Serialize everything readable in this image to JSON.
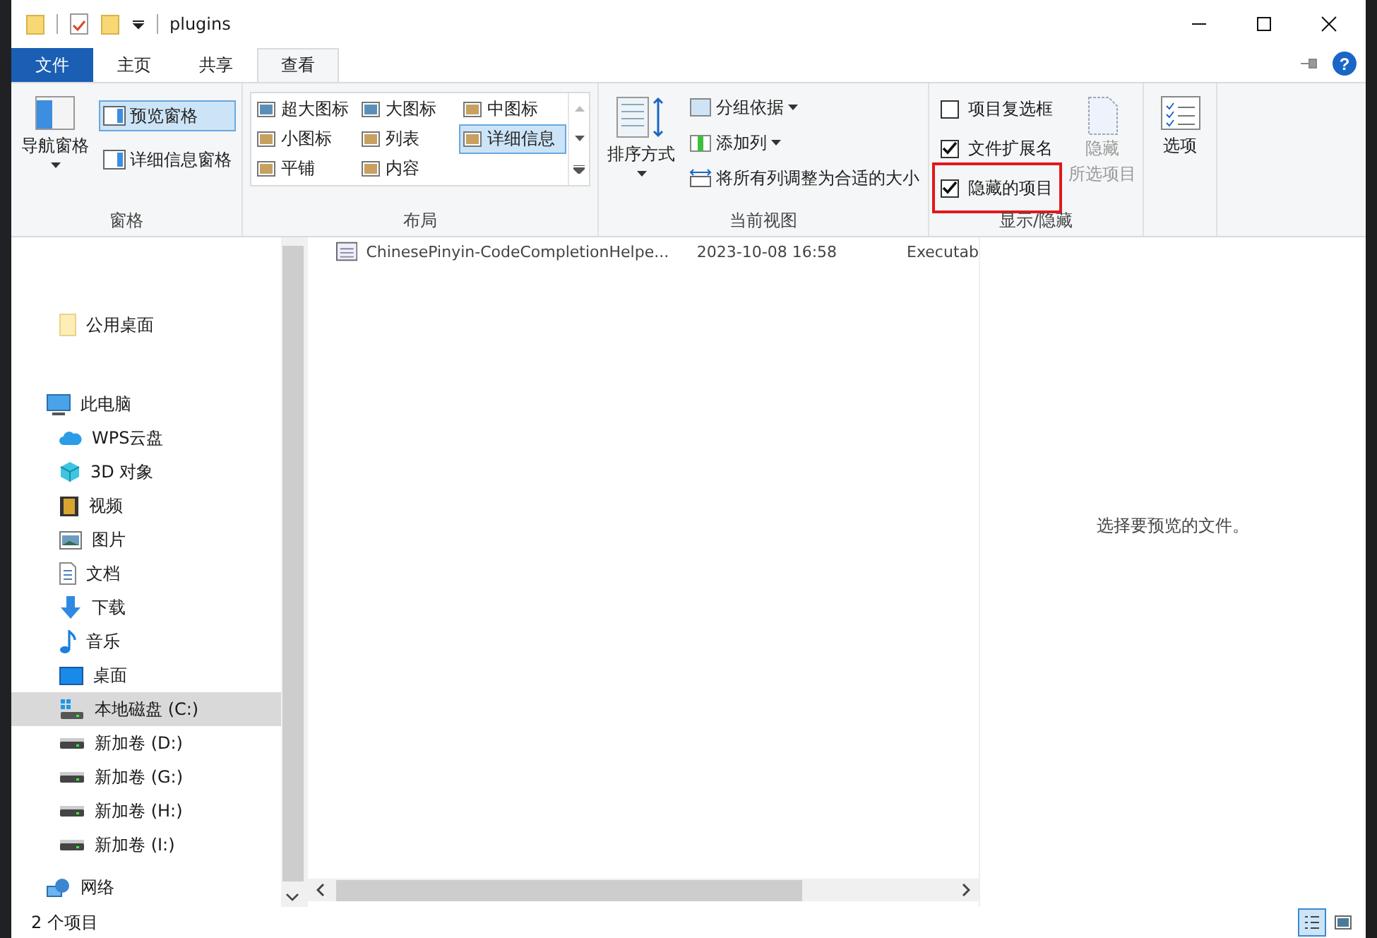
{
  "window": {
    "title": "plugins"
  },
  "ribbon_tabs": [
    {
      "label": "文件",
      "kind": "file",
      "selected": false
    },
    {
      "label": "主页",
      "kind": "normal",
      "selected": false
    },
    {
      "label": "共享",
      "kind": "normal",
      "selected": false
    },
    {
      "label": "查看",
      "kind": "normal",
      "selected": true
    }
  ],
  "panes_group": {
    "label": "窗格",
    "navigation_pane": "导航窗格",
    "preview_pane": {
      "label": "预览窗格",
      "selected": true
    },
    "details_pane": {
      "label": "详细信息窗格",
      "selected": false
    }
  },
  "layout_group": {
    "label": "布局",
    "options": [
      {
        "label": "超大图标",
        "selected": false
      },
      {
        "label": "大图标",
        "selected": false
      },
      {
        "label": "中图标",
        "selected": false
      },
      {
        "label": "小图标",
        "selected": false
      },
      {
        "label": "列表",
        "selected": false
      },
      {
        "label": "详细信息",
        "selected": true
      },
      {
        "label": "平铺",
        "selected": false
      },
      {
        "label": "内容",
        "selected": false
      }
    ]
  },
  "current_view_group": {
    "label": "当前视图",
    "sort_by": "排序方式",
    "group_by": "分组依据",
    "add_columns": "添加列",
    "size_all_columns": "将所有列调整为合适的大小"
  },
  "show_hide_group": {
    "label": "显示/隐藏",
    "checkboxes": [
      {
        "label": "项目复选框",
        "checked": false,
        "highlighted": false
      },
      {
        "label": "文件扩展名",
        "checked": true,
        "highlighted": false
      },
      {
        "label": "隐藏的项目",
        "checked": true,
        "highlighted": true
      }
    ],
    "hide_selected": {
      "line_1": "隐藏",
      "line_2": "所选项目",
      "disabled": true
    }
  },
  "options_button": "选项",
  "help_button": "?",
  "navigation": [
    {
      "children": [
        {
          "label": "公用桌面",
          "kind": "folder",
          "selected": false
        }
      ]
    },
    {
      "label": "此电脑",
      "children": [
        {
          "label": "WPS云盘",
          "kind": "cloud",
          "selected": false
        },
        {
          "label": "3D 对象",
          "kind": "cube",
          "selected": false
        },
        {
          "label": "视频",
          "kind": "video",
          "selected": false
        },
        {
          "label": "图片",
          "kind": "picture",
          "selected": false
        },
        {
          "label": "文档",
          "kind": "document",
          "selected": false
        },
        {
          "label": "下载",
          "kind": "download",
          "selected": false
        },
        {
          "label": "音乐",
          "kind": "music",
          "selected": false
        },
        {
          "label": "桌面",
          "kind": "desktop",
          "selected": false
        },
        {
          "label": "本地磁盘 (C:)",
          "kind": "system-drive",
          "selected": true
        },
        {
          "label": "新加卷 (D:)",
          "kind": "drive",
          "selected": false
        },
        {
          "label": "新加卷 (G:)",
          "kind": "drive",
          "selected": false
        },
        {
          "label": "新加卷 (H:)",
          "kind": "drive",
          "selected": false
        },
        {
          "label": "新加卷 (I:)",
          "kind": "drive",
          "selected": false
        }
      ]
    },
    {
      "label": "网络"
    }
  ],
  "files": [
    {
      "name": "ChinesePinyin-CodeCompletionHelpe...",
      "date": "2023-10-08 16:58",
      "type": "Executab"
    }
  ],
  "preview_message": "选择要预览的文件。",
  "status_bar": {
    "item_count": "2 个项目",
    "view_buttons": [
      {
        "kind": "details",
        "selected": true
      },
      {
        "kind": "large-icons",
        "selected": false
      }
    ]
  }
}
